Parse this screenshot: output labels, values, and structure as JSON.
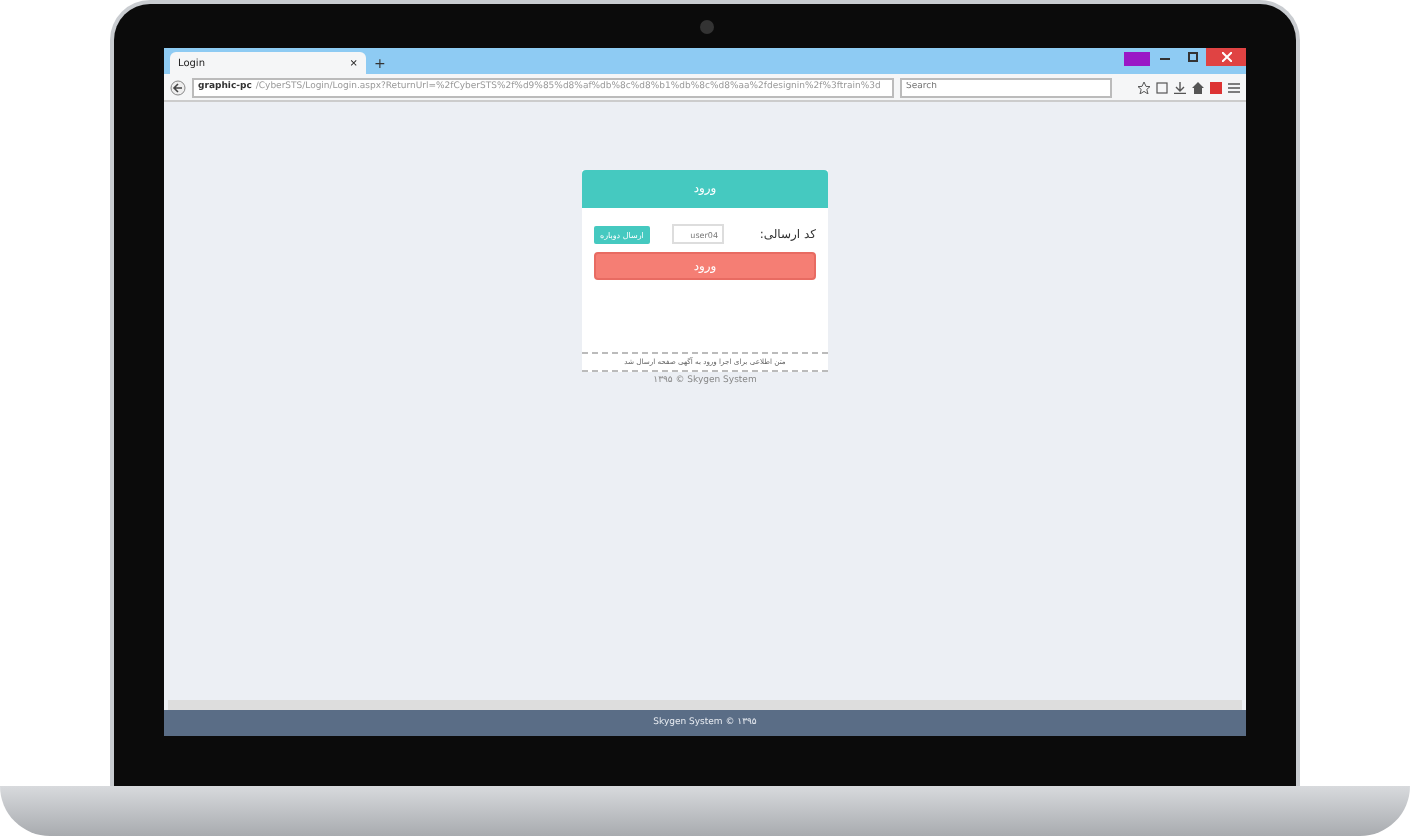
{
  "browser": {
    "tab": {
      "title": "Login",
      "close": "×"
    },
    "new_tab": "+",
    "address": {
      "host": "graphic-pc",
      "path": "/CyberSTS/Login/Login.aspx?ReturnUrl=%2fCyberSTS%2f%d9%85%d8%af%db%8c%d8%b1%db%8c%d8%aa%2fdesignin%2f%3ftrain%3d"
    },
    "search": {
      "placeholder": "Search"
    }
  },
  "login": {
    "header": "ورود",
    "code_label": "کد ارسالی:",
    "code_value": "user04",
    "resend_button": "ارسال دوباره",
    "submit_button": "ورود",
    "note": "متن اطلاعی برای اجرا ورود به آگهی صفحه ارسال شد",
    "copyright": "۱۳۹۵ © Skygen System"
  },
  "status_bar": "Skygen System © ۱۳۹۵"
}
